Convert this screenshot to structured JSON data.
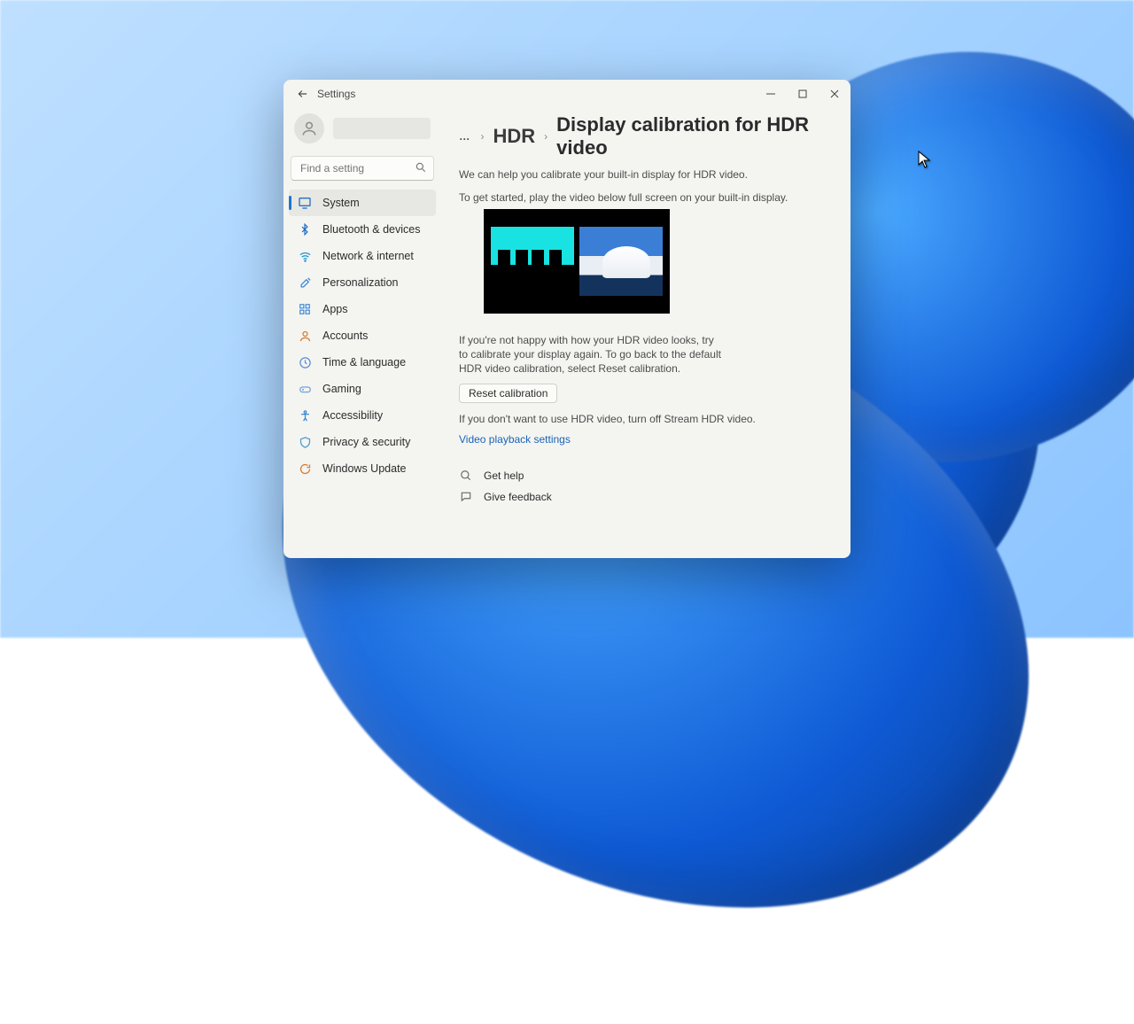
{
  "window": {
    "title": "Settings"
  },
  "search": {
    "placeholder": "Find a setting"
  },
  "sidebar": {
    "items": [
      {
        "label": "System"
      },
      {
        "label": "Bluetooth & devices"
      },
      {
        "label": "Network & internet"
      },
      {
        "label": "Personalization"
      },
      {
        "label": "Apps"
      },
      {
        "label": "Accounts"
      },
      {
        "label": "Time & language"
      },
      {
        "label": "Gaming"
      },
      {
        "label": "Accessibility"
      },
      {
        "label": "Privacy & security"
      },
      {
        "label": "Windows Update"
      }
    ]
  },
  "breadcrumb": {
    "ellipsis": "…",
    "hdr": "HDR",
    "title": "Display calibration for HDR video"
  },
  "main": {
    "intro": "We can help you calibrate your built-in display for HDR video.",
    "howto": "To get started, play the video below full screen on your built-in display.",
    "advice": "If you're not happy with how your HDR video looks, try to calibrate your display again. To go back to the default HDR video calibration, select Reset calibration.",
    "reset_label": "Reset calibration",
    "stream_off": "If you don't want to use HDR video, turn off Stream HDR video.",
    "playback_link": "Video playback settings"
  },
  "footer": {
    "help": "Get help",
    "feedback": "Give feedback"
  }
}
